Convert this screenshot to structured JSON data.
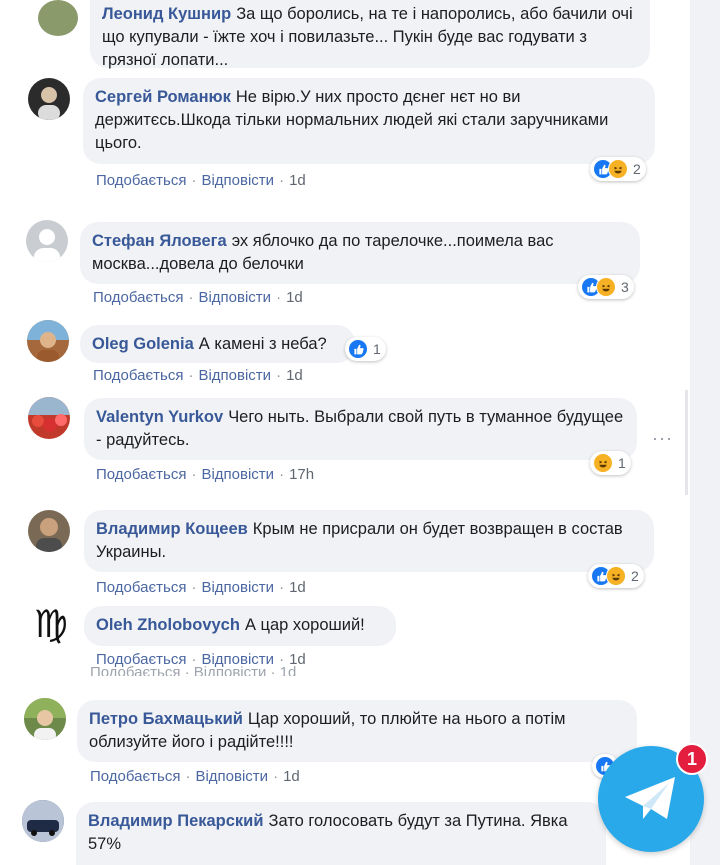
{
  "comments": [
    {
      "author": "Леонид Кушнир",
      "text": "За що боролись, на те і напоролись, або бачили очі що купували - їжте хоч і повилазьте... Пукін буде вас годувати з грязної лопати...",
      "avatar_color": "#8a9a6b"
    },
    {
      "author": "Сергей Романюк",
      "text": "Не вірю.У них просто дєнег нєт но ви держитєсь.Шкода тільки нормальних людей які стали заручниками цього.",
      "like": "Подобається",
      "reply": "Відповісти",
      "time": "1d",
      "reaction_count": "2",
      "avatar_color": "#2b2b2b"
    },
    {
      "author": "Стефан Яловега",
      "text": "эх яблочко да по тарелочке...поимела вас москва...довела до белочки",
      "like": "Подобається",
      "reply": "Відповісти",
      "time": "1d",
      "reaction_count": "3",
      "avatar_color": "#c9ccd1"
    },
    {
      "author": "Oleg Golenia",
      "text": "А камені з неба?",
      "like": "Подобається",
      "reply": "Відповісти",
      "time": "1d",
      "reaction_count": "1",
      "avatar_color": "#a5683c"
    },
    {
      "author": "Valentyn Yurkov",
      "text": "Чего ныть. Выбрали свой путь в туманное будущее - радуйтесь.",
      "like": "Подобається",
      "reply": "Відповісти",
      "time": "17h",
      "reaction_count": "1",
      "avatar_color": "#c0392b"
    },
    {
      "author": "Владимир Кощеев",
      "text": "Крым не присрали он будет возвращен в состав Украины.",
      "like": "Подобається",
      "reply": "Відповісти",
      "time": "1d",
      "reaction_count": "2",
      "avatar_color": "#7a6a55"
    },
    {
      "author": "Oleh Zholobovych",
      "text": "А цар хороший!",
      "like": "Подобається",
      "reply": "Відповісти",
      "time": "1d",
      "avatar_color": "#ffffff",
      "avatar_glyph": "♍"
    },
    {
      "author": "Петро Бахмацький",
      "text": "Цар хороший, то плюйте на нього а потім облизуйте його і радійте!!!!",
      "like": "Подобається",
      "reply": "Відповісти",
      "time": "1d",
      "avatar_color": "#6d8a4a"
    },
    {
      "author": "Владимир Пекарский",
      "text": "Зато голосовать будут за Путина. Явка 57%",
      "avatar_color": "#3b4a6b"
    }
  ],
  "ghost_line": "Подобається · Відповісти · 1d",
  "telegram": {
    "badge": "1",
    "icon": "telegram-plane-icon",
    "color": "#29a9ea"
  },
  "colors": {
    "author": "#385898",
    "bubble": "#f0f2f5",
    "like_blue": "#1877f2",
    "haha_yellow": "#f7b125"
  }
}
